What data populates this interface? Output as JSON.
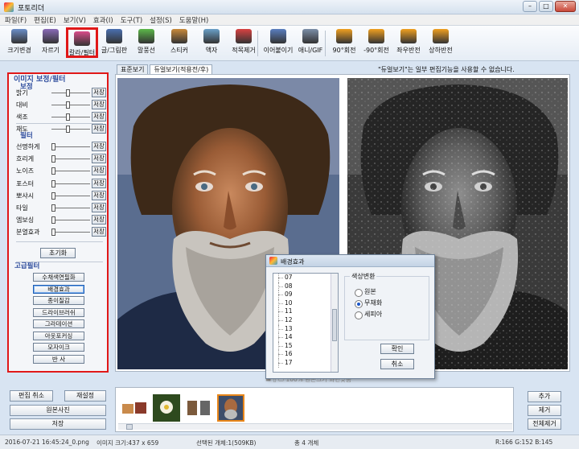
{
  "window": {
    "title": "포토리더",
    "min": "–",
    "max": "□",
    "close": "✕"
  },
  "menu": [
    "파일(F)",
    "편집(E)",
    "보기(V)",
    "효과(I)",
    "도구(T)",
    "설정(S)",
    "도움말(H)"
  ],
  "toolbar": [
    {
      "label": "크기변경",
      "color": "#6b8fc9"
    },
    {
      "label": "자르기",
      "color": "#8a6bb8"
    },
    {
      "label": "칼라/필터",
      "color": "#d94c8a"
    },
    {
      "label": "글/그림판",
      "color": "#4a6fb0"
    },
    {
      "label": "말풍선",
      "color": "#5cb84a"
    },
    {
      "label": "스티커",
      "color": "#c98a3b"
    },
    {
      "label": "액자",
      "color": "#6aa0c8"
    },
    {
      "label": "적목제거",
      "color": "#d94242"
    },
    {
      "label": "이어붙이기",
      "color": "#5a7fc0"
    },
    {
      "label": "애니/GIF",
      "color": "#7c8fa8"
    },
    {
      "label": "90°회전",
      "color": "#f0a020"
    },
    {
      "label": "-90°회전",
      "color": "#f0a020"
    },
    {
      "label": "좌우반전",
      "color": "#f0a020"
    },
    {
      "label": "상하반전",
      "color": "#f0a020"
    }
  ],
  "leftpanel": {
    "title": "이미지 보정/필터",
    "section_correct": "보정",
    "correct": [
      {
        "label": "밝기",
        "value": 0.42
      },
      {
        "label": "대비",
        "value": 0.42
      },
      {
        "label": "색조",
        "value": 0.42
      },
      {
        "label": "채도",
        "value": 0.42
      }
    ],
    "section_filter": "필터",
    "filters": [
      {
        "label": "선명하게",
        "value": 0.0
      },
      {
        "label": "흐리게",
        "value": 0.0
      },
      {
        "label": "노이즈",
        "value": 0.0
      },
      {
        "label": "포스터",
        "value": 0.0
      },
      {
        "label": "뽀샤시",
        "value": 0.0
      },
      {
        "label": "타일",
        "value": 0.0
      },
      {
        "label": "엠보싱",
        "value": 0.0
      },
      {
        "label": "분열효과",
        "value": 0.0
      }
    ],
    "save_label": "저장",
    "reset_label": "초기화",
    "section_advanced": "고급필터",
    "advanced": [
      "수채색연필화",
      "배경효과",
      "종이질감",
      "드라이브러쉬",
      "그라데이션",
      "아웃포커싱",
      "모자이크",
      "반      사"
    ],
    "advanced_active": 1
  },
  "tabs": [
    "표준보기",
    "듀얼보기(적용전/후)"
  ],
  "tab_active": 1,
  "notice": "\"듀얼보기\"는 일부 편집기능을 사용할 수 없습니다.",
  "below_viewer": "▬   ▯         ▭   100%      원본크기     화면맞춤",
  "dialog": {
    "title": "배경효과",
    "list": [
      "07",
      "08",
      "09",
      "10",
      "11",
      "12",
      "13",
      "14",
      "15",
      "16",
      "17"
    ],
    "group_title": "색상변환",
    "options": [
      "원본",
      "무채화",
      "세피아"
    ],
    "selected": 1,
    "ok": "확인",
    "cancel": "취소"
  },
  "bottom": {
    "undo": "편집 취소",
    "apply": "재설정",
    "original": "원본사진",
    "save": "저장",
    "add": "추가",
    "remove": "제거",
    "remove_all": "전체제거"
  },
  "status": {
    "file": "2016-07-21 16:45:24_0.png",
    "image": "이미지 크기:437 x 659",
    "selected": "선택된 개체:1(509KB)",
    "total": "총 4 개체",
    "rgb": "R:166 G:152 B:145"
  }
}
